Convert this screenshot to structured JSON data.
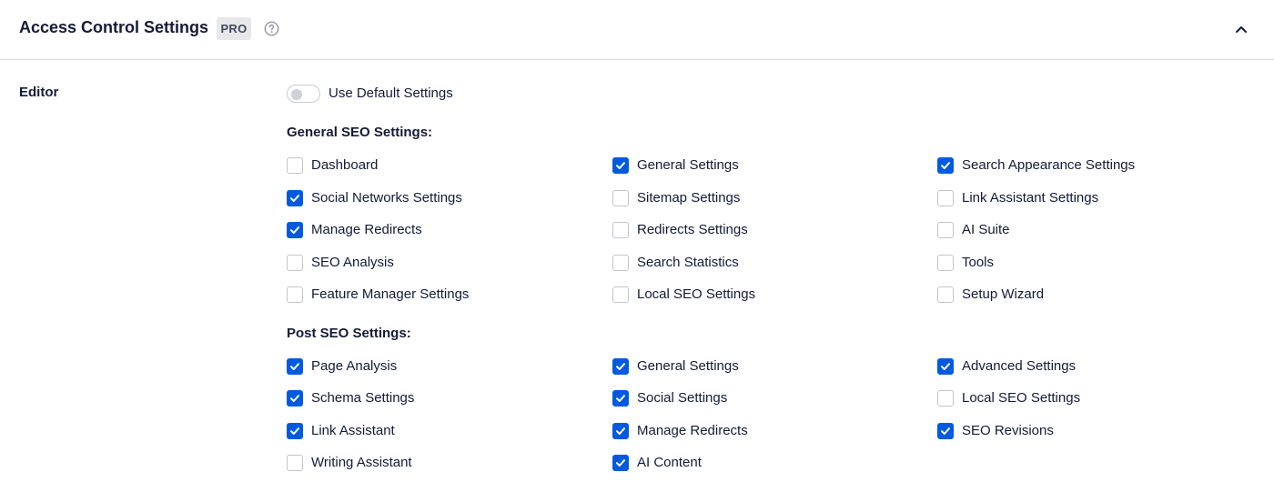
{
  "header": {
    "title": "Access Control Settings",
    "badge": "PRO",
    "help_icon": "question-circle-icon",
    "collapse_icon": "chevron-up-icon"
  },
  "role": {
    "label": "Editor",
    "default_toggle": {
      "label": "Use Default Settings",
      "on": false
    }
  },
  "general": {
    "title": "General SEO Settings:",
    "options": [
      {
        "label": "Dashboard",
        "checked": false
      },
      {
        "label": "General Settings",
        "checked": true
      },
      {
        "label": "Search Appearance Settings",
        "checked": true
      },
      {
        "label": "Social Networks Settings",
        "checked": true
      },
      {
        "label": "Sitemap Settings",
        "checked": false
      },
      {
        "label": "Link Assistant Settings",
        "checked": false
      },
      {
        "label": "Manage Redirects",
        "checked": true
      },
      {
        "label": "Redirects Settings",
        "checked": false
      },
      {
        "label": "AI Suite",
        "checked": false
      },
      {
        "label": "SEO Analysis",
        "checked": false
      },
      {
        "label": "Search Statistics",
        "checked": false
      },
      {
        "label": "Tools",
        "checked": false
      },
      {
        "label": "Feature Manager Settings",
        "checked": false
      },
      {
        "label": "Local SEO Settings",
        "checked": false
      },
      {
        "label": "Setup Wizard",
        "checked": false
      }
    ]
  },
  "post": {
    "title": "Post SEO Settings:",
    "options": [
      {
        "label": "Page Analysis",
        "checked": true
      },
      {
        "label": "General Settings",
        "checked": true
      },
      {
        "label": "Advanced Settings",
        "checked": true
      },
      {
        "label": "Schema Settings",
        "checked": true
      },
      {
        "label": "Social Settings",
        "checked": true
      },
      {
        "label": "Local SEO Settings",
        "checked": false
      },
      {
        "label": "Link Assistant",
        "checked": true
      },
      {
        "label": "Manage Redirects",
        "checked": true
      },
      {
        "label": "SEO Revisions",
        "checked": true
      },
      {
        "label": "Writing Assistant",
        "checked": false
      },
      {
        "label": "AI Content",
        "checked": true
      }
    ]
  },
  "colors": {
    "accent": "#005ae0",
    "text": "#141b38",
    "border": "#dcdde1"
  }
}
